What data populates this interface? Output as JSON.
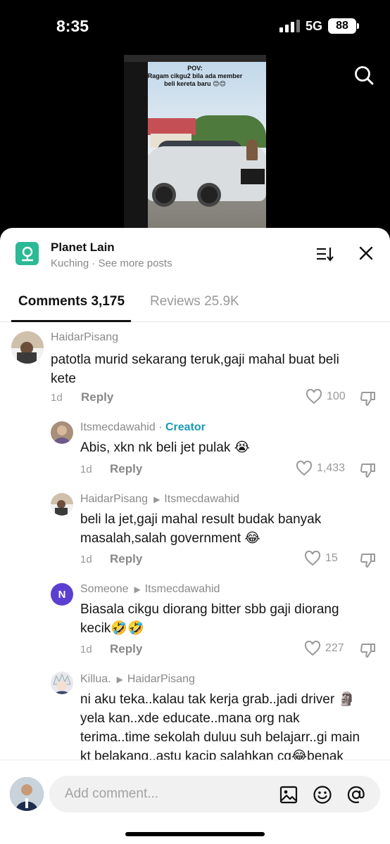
{
  "status": {
    "time": "8:35",
    "network": "5G",
    "battery": "88"
  },
  "video": {
    "caption_line1": "POV:",
    "caption_line2": "Ragam cikgu2 bila ada member",
    "caption_line3": "beli kereta baru 😊😊"
  },
  "header": {
    "title": "Planet Lain",
    "subtitle": "Kuching · See more posts"
  },
  "tabs": [
    {
      "label": "Comments 3,175"
    },
    {
      "label": "Reviews 25.9K"
    }
  ],
  "comments": [
    {
      "user": "HaidarPisang",
      "text_line1": "patotla murid sekarang teruk,gaji mahal buat beli",
      "text_line2": "kete",
      "time": "1d",
      "reply": "Reply",
      "likes": "100"
    },
    {
      "user": "Itsmecdawahid",
      "badge": "Creator",
      "text_line1": "Abis, xkn nk beli jet pulak 😭",
      "time": "1d",
      "reply": "Reply",
      "likes": "1,433"
    },
    {
      "user": "HaidarPisang",
      "reply_to": "Itsmecdawahid",
      "text_line1": "beli la jet,gaji mahal result budak banyak",
      "text_line2": "masalah,salah government 😂",
      "time": "1d",
      "reply": "Reply",
      "likes": "15"
    },
    {
      "user": "Someone",
      "reply_to": "Itsmecdawahid",
      "avatar_letter": "N",
      "text_line1": "Biasala cikgu diorang bitter sbb gaji diorang",
      "text_line2": "kecik🤣🤣",
      "time": "1d",
      "reply": "Reply",
      "likes": "227"
    },
    {
      "user": "Killua.",
      "reply_to": "HaidarPisang",
      "text_line1": "ni aku teka..kalau tak kerja grab..jadi driver 🗿",
      "text_line2": "yela kan..xde educate..mana org nak",
      "text_line3": "terima..time sekolah duluu suh belajarr..gi main",
      "text_line4": "kt belakang..astu kacip salahkan cg😂benak"
    }
  ],
  "composer": {
    "placeholder": "Add comment..."
  },
  "colors": {
    "accent": "#1a9ab4",
    "place_icon": "#2bb996"
  }
}
